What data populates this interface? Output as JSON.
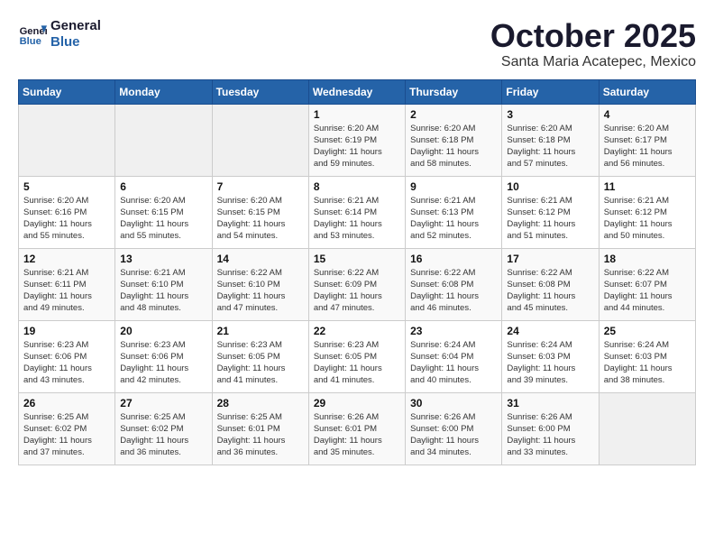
{
  "logo": {
    "line1": "General",
    "line2": "Blue"
  },
  "title": "October 2025",
  "location": "Santa Maria Acatepec, Mexico",
  "days_header": [
    "Sunday",
    "Monday",
    "Tuesday",
    "Wednesday",
    "Thursday",
    "Friday",
    "Saturday"
  ],
  "weeks": [
    [
      {
        "day": "",
        "info": ""
      },
      {
        "day": "",
        "info": ""
      },
      {
        "day": "",
        "info": ""
      },
      {
        "day": "1",
        "info": "Sunrise: 6:20 AM\nSunset: 6:19 PM\nDaylight: 11 hours\nand 59 minutes."
      },
      {
        "day": "2",
        "info": "Sunrise: 6:20 AM\nSunset: 6:18 PM\nDaylight: 11 hours\nand 58 minutes."
      },
      {
        "day": "3",
        "info": "Sunrise: 6:20 AM\nSunset: 6:18 PM\nDaylight: 11 hours\nand 57 minutes."
      },
      {
        "day": "4",
        "info": "Sunrise: 6:20 AM\nSunset: 6:17 PM\nDaylight: 11 hours\nand 56 minutes."
      }
    ],
    [
      {
        "day": "5",
        "info": "Sunrise: 6:20 AM\nSunset: 6:16 PM\nDaylight: 11 hours\nand 55 minutes."
      },
      {
        "day": "6",
        "info": "Sunrise: 6:20 AM\nSunset: 6:15 PM\nDaylight: 11 hours\nand 55 minutes."
      },
      {
        "day": "7",
        "info": "Sunrise: 6:20 AM\nSunset: 6:15 PM\nDaylight: 11 hours\nand 54 minutes."
      },
      {
        "day": "8",
        "info": "Sunrise: 6:21 AM\nSunset: 6:14 PM\nDaylight: 11 hours\nand 53 minutes."
      },
      {
        "day": "9",
        "info": "Sunrise: 6:21 AM\nSunset: 6:13 PM\nDaylight: 11 hours\nand 52 minutes."
      },
      {
        "day": "10",
        "info": "Sunrise: 6:21 AM\nSunset: 6:12 PM\nDaylight: 11 hours\nand 51 minutes."
      },
      {
        "day": "11",
        "info": "Sunrise: 6:21 AM\nSunset: 6:12 PM\nDaylight: 11 hours\nand 50 minutes."
      }
    ],
    [
      {
        "day": "12",
        "info": "Sunrise: 6:21 AM\nSunset: 6:11 PM\nDaylight: 11 hours\nand 49 minutes."
      },
      {
        "day": "13",
        "info": "Sunrise: 6:21 AM\nSunset: 6:10 PM\nDaylight: 11 hours\nand 48 minutes."
      },
      {
        "day": "14",
        "info": "Sunrise: 6:22 AM\nSunset: 6:10 PM\nDaylight: 11 hours\nand 47 minutes."
      },
      {
        "day": "15",
        "info": "Sunrise: 6:22 AM\nSunset: 6:09 PM\nDaylight: 11 hours\nand 47 minutes."
      },
      {
        "day": "16",
        "info": "Sunrise: 6:22 AM\nSunset: 6:08 PM\nDaylight: 11 hours\nand 46 minutes."
      },
      {
        "day": "17",
        "info": "Sunrise: 6:22 AM\nSunset: 6:08 PM\nDaylight: 11 hours\nand 45 minutes."
      },
      {
        "day": "18",
        "info": "Sunrise: 6:22 AM\nSunset: 6:07 PM\nDaylight: 11 hours\nand 44 minutes."
      }
    ],
    [
      {
        "day": "19",
        "info": "Sunrise: 6:23 AM\nSunset: 6:06 PM\nDaylight: 11 hours\nand 43 minutes."
      },
      {
        "day": "20",
        "info": "Sunrise: 6:23 AM\nSunset: 6:06 PM\nDaylight: 11 hours\nand 42 minutes."
      },
      {
        "day": "21",
        "info": "Sunrise: 6:23 AM\nSunset: 6:05 PM\nDaylight: 11 hours\nand 41 minutes."
      },
      {
        "day": "22",
        "info": "Sunrise: 6:23 AM\nSunset: 6:05 PM\nDaylight: 11 hours\nand 41 minutes."
      },
      {
        "day": "23",
        "info": "Sunrise: 6:24 AM\nSunset: 6:04 PM\nDaylight: 11 hours\nand 40 minutes."
      },
      {
        "day": "24",
        "info": "Sunrise: 6:24 AM\nSunset: 6:03 PM\nDaylight: 11 hours\nand 39 minutes."
      },
      {
        "day": "25",
        "info": "Sunrise: 6:24 AM\nSunset: 6:03 PM\nDaylight: 11 hours\nand 38 minutes."
      }
    ],
    [
      {
        "day": "26",
        "info": "Sunrise: 6:25 AM\nSunset: 6:02 PM\nDaylight: 11 hours\nand 37 minutes."
      },
      {
        "day": "27",
        "info": "Sunrise: 6:25 AM\nSunset: 6:02 PM\nDaylight: 11 hours\nand 36 minutes."
      },
      {
        "day": "28",
        "info": "Sunrise: 6:25 AM\nSunset: 6:01 PM\nDaylight: 11 hours\nand 36 minutes."
      },
      {
        "day": "29",
        "info": "Sunrise: 6:26 AM\nSunset: 6:01 PM\nDaylight: 11 hours\nand 35 minutes."
      },
      {
        "day": "30",
        "info": "Sunrise: 6:26 AM\nSunset: 6:00 PM\nDaylight: 11 hours\nand 34 minutes."
      },
      {
        "day": "31",
        "info": "Sunrise: 6:26 AM\nSunset: 6:00 PM\nDaylight: 11 hours\nand 33 minutes."
      },
      {
        "day": "",
        "info": ""
      }
    ]
  ]
}
